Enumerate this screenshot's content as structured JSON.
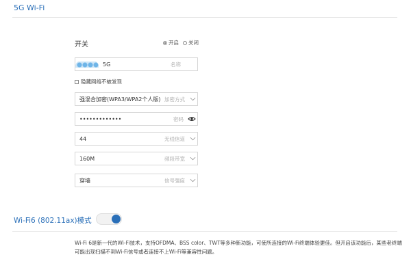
{
  "section1": {
    "title": "5G Wi-Fi"
  },
  "switch": {
    "label": "开关",
    "options": [
      {
        "label": "开启",
        "selected": true
      },
      {
        "label": "关闭",
        "selected": false
      }
    ]
  },
  "ssid": {
    "value": "5G",
    "hint": "名称"
  },
  "hide_network": {
    "label": "隐藏网络不被发现",
    "checked": false
  },
  "encryption": {
    "value": "强混合加密(WPA3/WPA2个人版)",
    "hint": "加密方式"
  },
  "password": {
    "value": "•••••••••••••",
    "hint": "密码"
  },
  "channel": {
    "value": "44",
    "hint": "无线信道"
  },
  "bandwidth": {
    "value": "160M",
    "hint": "频段带宽"
  },
  "signal": {
    "value": "穿墙",
    "hint": "信号强度"
  },
  "wifi6": {
    "title": "Wi-Fi6 (802.11ax)模式",
    "enabled": true,
    "description": "Wi-Fi 6是新一代的Wi-Fi技术，支持OFDMA、BSS color、TWT等多种新功能，可使所连接的Wi-Fi终端体验更佳。但开启该功能后，某些老终端可能出现扫描不到Wi-Fi信号或者连接不上Wi-Fi等兼容性问题。"
  },
  "colors": {
    "accent": "#2a6fb8"
  }
}
